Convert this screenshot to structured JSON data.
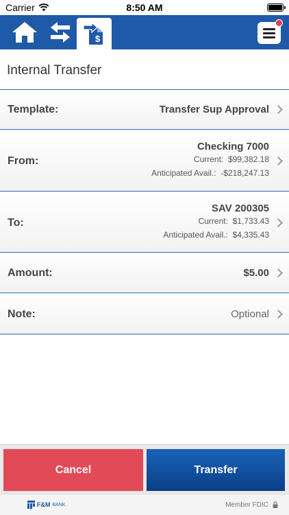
{
  "status_bar": {
    "carrier": "Carrier",
    "time": "8:50 AM"
  },
  "nav": {
    "items": [
      {
        "icon": "home-icon"
      },
      {
        "icon": "swap-arrows-icon"
      },
      {
        "icon": "transfer-money-icon",
        "active": true
      }
    ],
    "menu_icon": "hamburger-menu-icon",
    "menu_badge_color": "#e4414f",
    "bar_color": "#1f5aa8"
  },
  "page": {
    "title": "Internal Transfer"
  },
  "form": {
    "template": {
      "label": "Template:",
      "value": "Transfer Sup Approval"
    },
    "from": {
      "label": "From:",
      "account": "Checking 7000",
      "current_label": "Current:",
      "current_value": "$99,382.18",
      "anticipated_label": "Anticipated Avail.:",
      "anticipated_value": "-$218,247.13"
    },
    "to": {
      "label": "To:",
      "account": "SAV 200305",
      "current_label": "Current:",
      "current_value": "$1,733.43",
      "anticipated_label": "Anticipated Avail.:",
      "anticipated_value": "$4,335.43"
    },
    "amount": {
      "label": "Amount:",
      "value": "$5.00"
    },
    "note": {
      "label": "Note:",
      "placeholder": "Optional"
    }
  },
  "actions": {
    "cancel_label": "Cancel",
    "transfer_label": "Transfer",
    "cancel_color": "#e24a57",
    "transfer_color": "#0b3f86"
  },
  "footer": {
    "brand": "F&M",
    "brand_suffix": "BANK",
    "member": "Member FDIC"
  }
}
